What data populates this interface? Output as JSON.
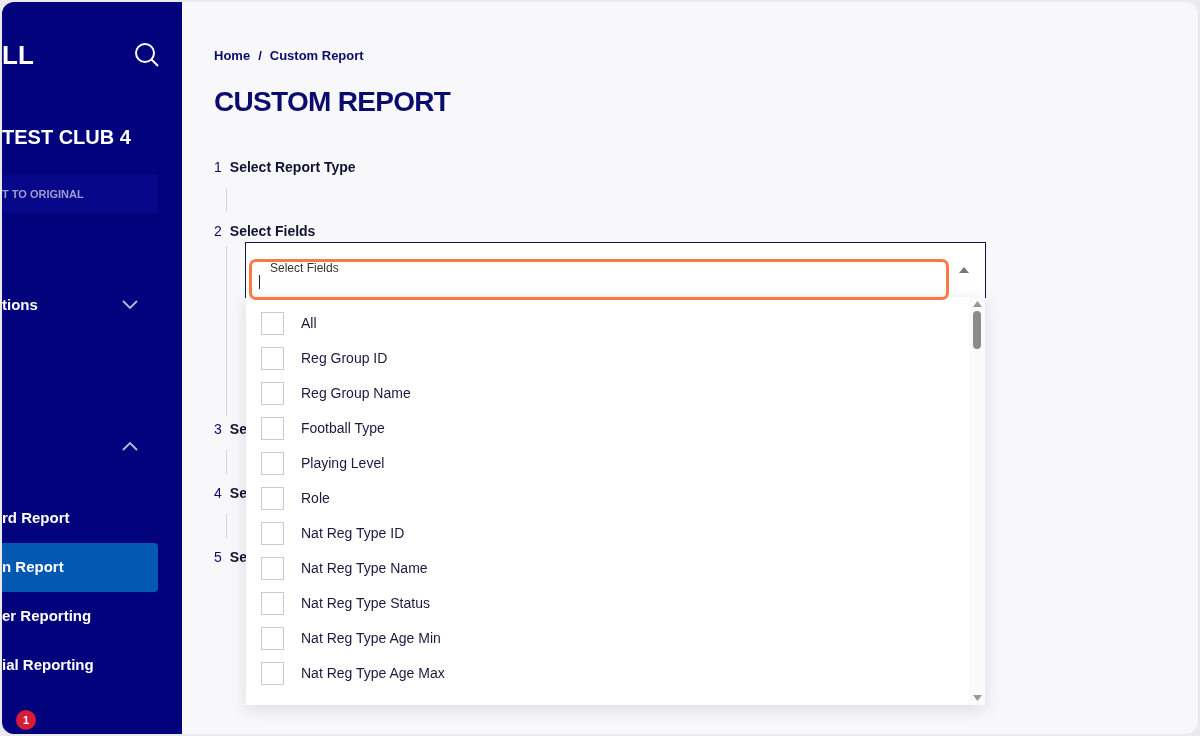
{
  "sidebar": {
    "logo": "LL",
    "club": "TEST CLUB 4",
    "revert_button": "T TO ORIGINAL",
    "sections": [
      {
        "label": "tions",
        "expanded": false
      },
      {
        "expanded": true
      }
    ],
    "items": [
      {
        "label": "rd Report",
        "selected": false
      },
      {
        "label": "n Report",
        "selected": true
      },
      {
        "label": "er Reporting",
        "selected": false
      },
      {
        "label": "ial Reporting",
        "selected": false
      }
    ],
    "badge": "1"
  },
  "breadcrumb": {
    "items": [
      "Home",
      "Custom Report"
    ],
    "separator": "/"
  },
  "title": "CUSTOM REPORT",
  "steps": [
    {
      "number": "1",
      "label": "Select Report Type"
    },
    {
      "number": "2",
      "label": "Select Fields"
    },
    {
      "number": "3",
      "label": "Se"
    },
    {
      "number": "4",
      "label": "Se"
    },
    {
      "number": "5",
      "label": "Se"
    }
  ],
  "field": {
    "label": "Select Fields",
    "expanded": true
  },
  "options": [
    {
      "label": "All",
      "checked": false
    },
    {
      "label": "Reg Group ID",
      "checked": false
    },
    {
      "label": "Reg Group Name",
      "checked": false
    },
    {
      "label": "Football Type",
      "checked": false
    },
    {
      "label": "Playing Level",
      "checked": false
    },
    {
      "label": "Role",
      "checked": false
    },
    {
      "label": "Nat Reg Type ID",
      "checked": false
    },
    {
      "label": "Nat Reg Type Name",
      "checked": false
    },
    {
      "label": "Nat Reg Type Status",
      "checked": false
    },
    {
      "label": "Nat Reg Type Age Min",
      "checked": false
    },
    {
      "label": "Nat Reg Type Age Max",
      "checked": false
    }
  ]
}
